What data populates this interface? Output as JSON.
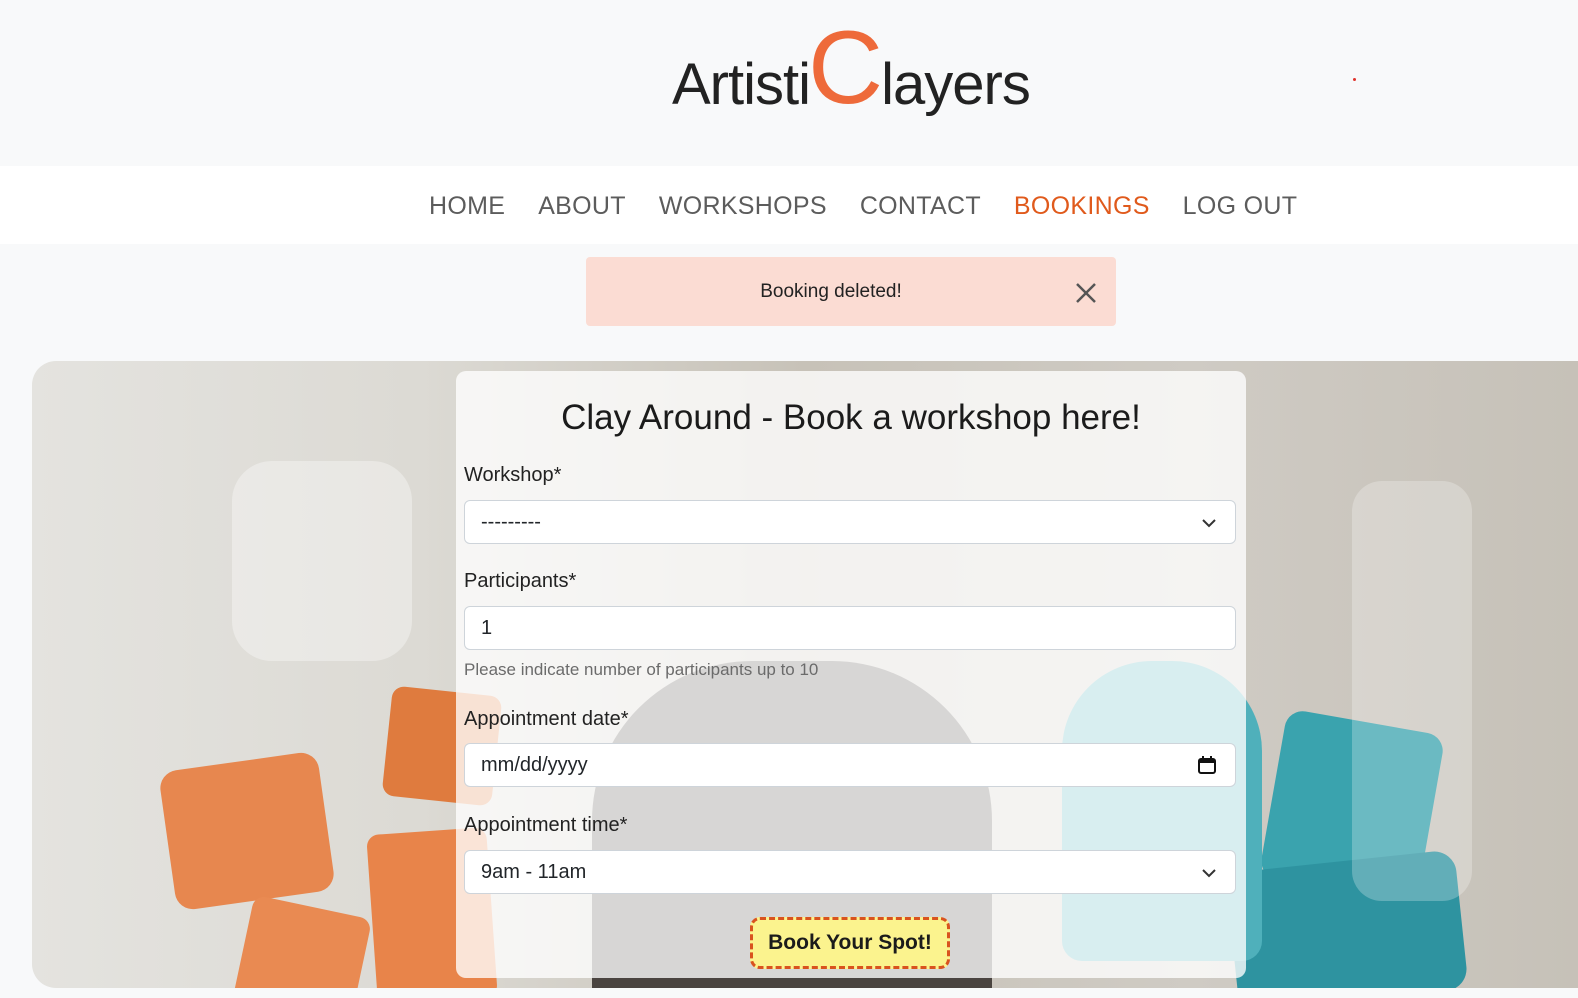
{
  "brand": {
    "prefix": "Artisti",
    "initial": "C",
    "suffix": "layers",
    "accent_color": "#ee6a3a"
  },
  "nav": {
    "items": [
      {
        "label": "HOME"
      },
      {
        "label": "ABOUT"
      },
      {
        "label": "WORKSHOPS"
      },
      {
        "label": "CONTACT"
      },
      {
        "label": "BOOKINGS",
        "active": true
      },
      {
        "label": "LOG OUT"
      }
    ],
    "active_color": "#e05a1c"
  },
  "alert": {
    "message": "Booking deleted!",
    "close_icon": "close-icon",
    "background": "#fbdcd3"
  },
  "form": {
    "title": "Clay Around - Book a workshop here!",
    "workshop": {
      "label": "Workshop*",
      "value": "---------"
    },
    "participants": {
      "label": "Participants*",
      "value": "1",
      "help": "Please indicate number of participants up to 10"
    },
    "date": {
      "label": "Appointment date*",
      "placeholder": "mm/dd/yyyy"
    },
    "time": {
      "label": "Appointment time*",
      "value": "9am - 11am"
    },
    "submit_label": "Book Your Spot!"
  }
}
